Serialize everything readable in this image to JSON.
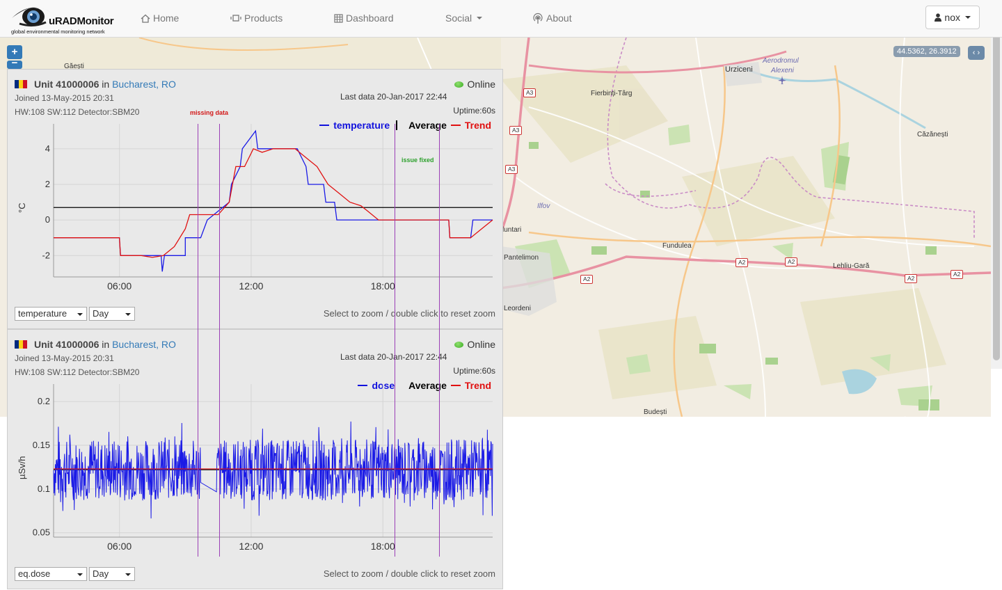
{
  "nav": {
    "logo_title": "uRADMonitor",
    "logo_sub": "global environmental monitoring network",
    "items": [
      {
        "label": "Home",
        "icon": "home-icon"
      },
      {
        "label": "Products",
        "icon": "products-icon"
      },
      {
        "label": "Dashboard",
        "icon": "dashboard-icon"
      },
      {
        "label": "Social",
        "icon": "caret-down-icon"
      },
      {
        "label": "About",
        "icon": "about-icon"
      }
    ],
    "user": "nox"
  },
  "map": {
    "zoom_in": "+",
    "zoom_out": "−",
    "coords": "44.5362, 26.3912",
    "toggle": "‹ ›",
    "places": [
      "Găești",
      "Urziceni",
      "Aerodromul",
      "Alexeni",
      "Fierbinți-Târg",
      "Căzănești",
      "Ilfov",
      "luntari",
      "Pantelimon",
      "Fundulea",
      "Lehliu-Gară",
      "Leordeni",
      "Budești"
    ],
    "roads": [
      "A3",
      "A3",
      "A3",
      "A2",
      "A2",
      "A2",
      "A2",
      "A2"
    ]
  },
  "annotations": {
    "missing": "missing data",
    "fixed": "issue fixed"
  },
  "panels": [
    {
      "unit": "Unit 41000006",
      "in": "in",
      "city": "Bucharest, RO",
      "joined": "Joined 13-May-2015 20:31",
      "hw": "HW:108 SW:112 Detector:SBM20",
      "status": "Online",
      "last_data": "Last data 20-Jan-2017 22:44",
      "uptime": "Uptime:60s",
      "legend_series": "temperature",
      "legend_avg": "Average",
      "legend_trend": "Trend",
      "ylabel": "°C",
      "select_metric": "temperature",
      "select_range": "Day",
      "hint": "Select to zoom / double click to reset zoom"
    },
    {
      "unit": "Unit 41000006",
      "in": "in",
      "city": "Bucharest, RO",
      "joined": "Joined 13-May-2015 20:31",
      "hw": "HW:108 SW:112 Detector:SBM20",
      "status": "Online",
      "last_data": "Last data 20-Jan-2017 22:44",
      "uptime": "Uptime:60s",
      "legend_series": "dose",
      "legend_avg": "Average",
      "legend_trend": "Trend",
      "ylabel": "µSv/h",
      "select_metric": "eq.dose",
      "select_range": "Day",
      "hint": "Select to zoom / double click to reset zoom"
    }
  ],
  "chart_data": [
    {
      "type": "line",
      "xlabel": "",
      "ylabel": "°C",
      "x_ticks": [
        "06:00",
        "12:00",
        "18:00"
      ],
      "y_ticks": [
        "4",
        "2",
        "0",
        "-2"
      ],
      "ylim": [
        -3.2,
        5.4
      ],
      "x_range_hours": [
        3,
        23
      ],
      "average": 0.7,
      "series": [
        {
          "name": "temperature",
          "color": "#1a1ae6",
          "x": [
            3.0,
            6.0,
            6.05,
            7.0,
            7.9,
            7.95,
            8.05,
            8.1,
            8.6,
            9.0,
            9.0,
            9.7,
            9.7,
            10.0,
            11.0,
            11.1,
            11.5,
            11.6,
            12.2,
            12.3,
            14.0,
            14.1,
            14.5,
            14.6,
            15.3,
            15.4,
            15.8,
            15.9,
            16.3,
            16.4,
            17.2,
            17.3,
            18.0,
            18.1,
            21.0,
            21.05,
            22.0,
            22.1,
            23.0
          ],
          "y": [
            -1.0,
            -1.0,
            -2.0,
            -2.0,
            -2.0,
            -2.9,
            -2.0,
            -2.0,
            -2.0,
            -2.0,
            -1.0,
            -1.0,
            -1.0,
            0.0,
            1.0,
            2.0,
            3.0,
            4.0,
            5.0,
            4.0,
            4.0,
            4.0,
            3.0,
            2.0,
            2.0,
            1.0,
            1.0,
            0.0,
            0.0,
            0.0,
            0.0,
            0.0,
            0.0,
            0.0,
            0.0,
            -1.0,
            -1.0,
            0.0,
            0.0
          ]
        },
        {
          "name": "Trend",
          "color": "#e01010",
          "x": [
            3.0,
            6.0,
            6.05,
            7.0,
            7.5,
            8.0,
            8.5,
            9.0,
            9.2,
            10.0,
            10.5,
            11.0,
            11.3,
            11.7,
            12.1,
            12.5,
            13.0,
            14.0,
            14.5,
            15.0,
            15.5,
            16.0,
            16.5,
            17.0,
            17.3,
            17.8,
            18.3,
            19.5,
            21.0,
            21.05,
            22.0,
            22.5,
            23.0
          ],
          "y": [
            -1.0,
            -1.0,
            -2.0,
            -2.0,
            -2.1,
            -2.0,
            -1.5,
            -0.5,
            0.3,
            0.3,
            0.3,
            1.0,
            3.0,
            3.0,
            4.0,
            3.8,
            4.0,
            4.0,
            3.5,
            3.0,
            2.0,
            1.5,
            1.0,
            0.8,
            0.5,
            0.0,
            0.0,
            0.0,
            0.0,
            -1.0,
            -1.0,
            -0.5,
            0.0
          ]
        }
      ]
    },
    {
      "type": "line",
      "xlabel": "",
      "ylabel": "µSv/h",
      "x_ticks": [
        "06:00",
        "12:00",
        "18:00"
      ],
      "y_ticks": [
        "0.2",
        "0.15",
        "0.1",
        "0.05"
      ],
      "ylim": [
        0.045,
        0.22
      ],
      "x_range_hours": [
        3,
        23
      ],
      "average": 0.122,
      "series": [
        {
          "name": "dose",
          "color": "#1a1ae6",
          "mean": 0.122,
          "spread": 0.035,
          "gap": [
            9.7,
            10.4
          ]
        },
        {
          "name": "Trend",
          "color": "#e01010",
          "value": 0.123
        }
      ]
    }
  ]
}
